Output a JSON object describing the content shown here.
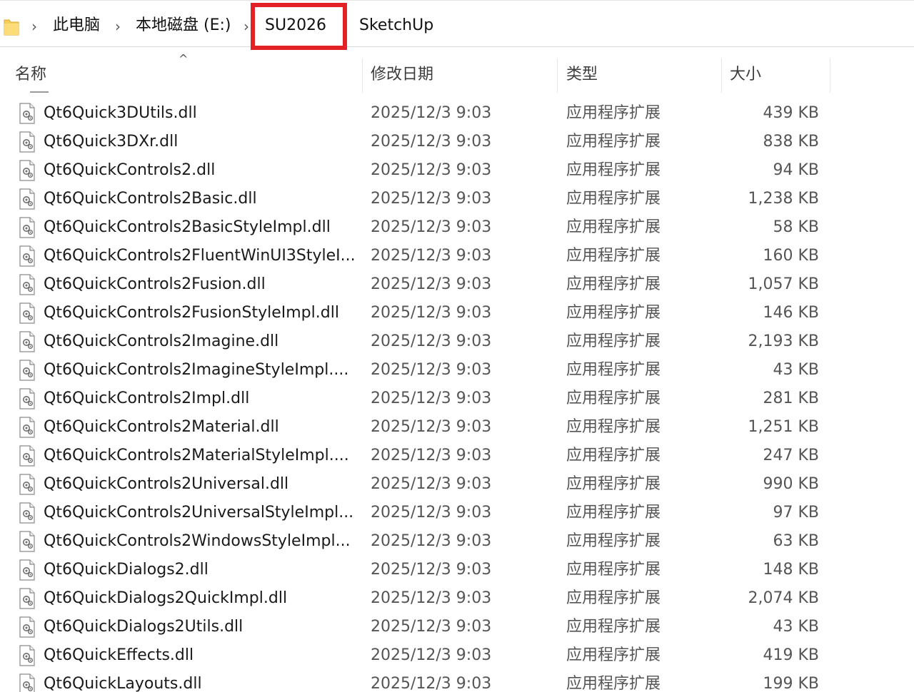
{
  "breadcrumb": {
    "items": [
      "此电脑",
      "本地磁盘 (E:)",
      "SU2026",
      "SketchUp"
    ],
    "separator": "›",
    "highlighted_item": "SU2026",
    "highlight_color": "#e32227"
  },
  "columns": {
    "name": "名称",
    "date": "修改日期",
    "type": "类型",
    "size": "大小",
    "sort_indicator": "^"
  },
  "icons": {
    "folder": "folder-icon",
    "file": "dll-file-icon"
  },
  "files": [
    {
      "name": "Qt6Quick3DUtils.dll",
      "date": "2025/12/3 9:03",
      "type": "应用程序扩展",
      "size": "439 KB"
    },
    {
      "name": "Qt6Quick3DXr.dll",
      "date": "2025/12/3 9:03",
      "type": "应用程序扩展",
      "size": "838 KB"
    },
    {
      "name": "Qt6QuickControls2.dll",
      "date": "2025/12/3 9:03",
      "type": "应用程序扩展",
      "size": "94 KB"
    },
    {
      "name": "Qt6QuickControls2Basic.dll",
      "date": "2025/12/3 9:03",
      "type": "应用程序扩展",
      "size": "1,238 KB"
    },
    {
      "name": "Qt6QuickControls2BasicStyleImpl.dll",
      "date": "2025/12/3 9:03",
      "type": "应用程序扩展",
      "size": "58 KB"
    },
    {
      "name": "Qt6QuickControls2FluentWinUI3StyleI...",
      "date": "2025/12/3 9:03",
      "type": "应用程序扩展",
      "size": "160 KB"
    },
    {
      "name": "Qt6QuickControls2Fusion.dll",
      "date": "2025/12/3 9:03",
      "type": "应用程序扩展",
      "size": "1,057 KB"
    },
    {
      "name": "Qt6QuickControls2FusionStyleImpl.dll",
      "date": "2025/12/3 9:03",
      "type": "应用程序扩展",
      "size": "146 KB"
    },
    {
      "name": "Qt6QuickControls2Imagine.dll",
      "date": "2025/12/3 9:03",
      "type": "应用程序扩展",
      "size": "2,193 KB"
    },
    {
      "name": "Qt6QuickControls2ImagineStyleImpl....",
      "date": "2025/12/3 9:03",
      "type": "应用程序扩展",
      "size": "43 KB"
    },
    {
      "name": "Qt6QuickControls2Impl.dll",
      "date": "2025/12/3 9:03",
      "type": "应用程序扩展",
      "size": "281 KB"
    },
    {
      "name": "Qt6QuickControls2Material.dll",
      "date": "2025/12/3 9:03",
      "type": "应用程序扩展",
      "size": "1,251 KB"
    },
    {
      "name": "Qt6QuickControls2MaterialStyleImpl....",
      "date": "2025/12/3 9:03",
      "type": "应用程序扩展",
      "size": "247 KB"
    },
    {
      "name": "Qt6QuickControls2Universal.dll",
      "date": "2025/12/3 9:03",
      "type": "应用程序扩展",
      "size": "990 KB"
    },
    {
      "name": "Qt6QuickControls2UniversalStyleImpl...",
      "date": "2025/12/3 9:03",
      "type": "应用程序扩展",
      "size": "97 KB"
    },
    {
      "name": "Qt6QuickControls2WindowsStyleImpl...",
      "date": "2025/12/3 9:03",
      "type": "应用程序扩展",
      "size": "63 KB"
    },
    {
      "name": "Qt6QuickDialogs2.dll",
      "date": "2025/12/3 9:03",
      "type": "应用程序扩展",
      "size": "148 KB"
    },
    {
      "name": "Qt6QuickDialogs2QuickImpl.dll",
      "date": "2025/12/3 9:03",
      "type": "应用程序扩展",
      "size": "2,074 KB"
    },
    {
      "name": "Qt6QuickDialogs2Utils.dll",
      "date": "2025/12/3 9:03",
      "type": "应用程序扩展",
      "size": "43 KB"
    },
    {
      "name": "Qt6QuickEffects.dll",
      "date": "2025/12/3 9:03",
      "type": "应用程序扩展",
      "size": "419 KB"
    },
    {
      "name": "Qt6QuickLayouts.dll",
      "date": "2025/12/3 9:03",
      "type": "应用程序扩展",
      "size": "199 KB"
    }
  ]
}
